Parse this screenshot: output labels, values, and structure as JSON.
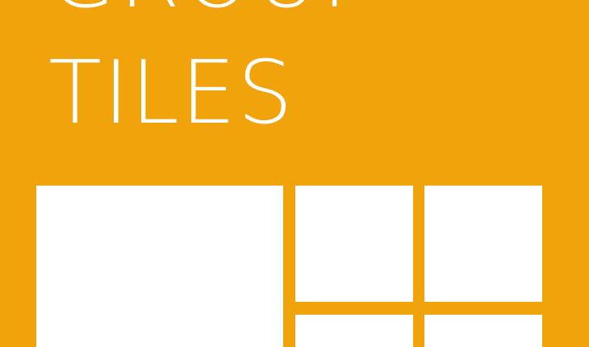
{
  "theme": {
    "accent_color": "#F0A30A",
    "tile_color": "#FFFFFF"
  },
  "title": {
    "line1": "GROUP",
    "line2": "TILES"
  },
  "tiles": [
    {
      "size": "large"
    },
    {
      "size": "small"
    },
    {
      "size": "small"
    },
    {
      "size": "small"
    },
    {
      "size": "small"
    }
  ]
}
